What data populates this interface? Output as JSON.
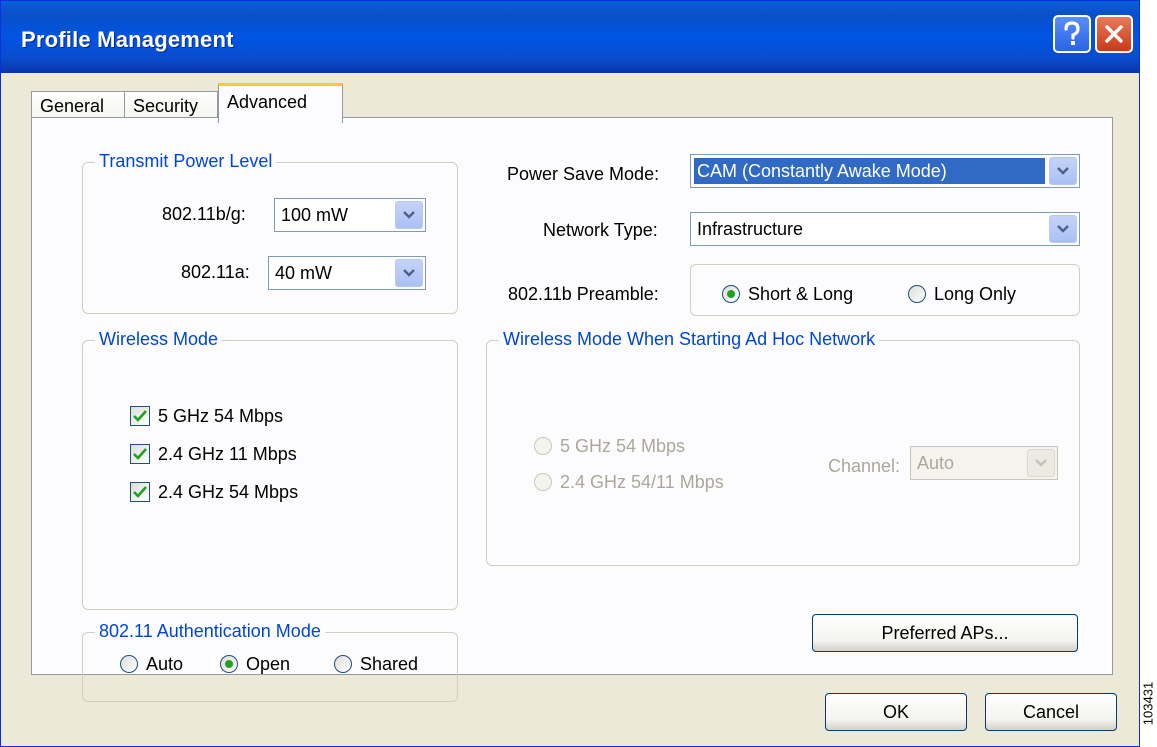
{
  "window": {
    "title": "Profile Management"
  },
  "tabs": [
    {
      "label": "General"
    },
    {
      "label": "Security"
    },
    {
      "label": "Advanced"
    }
  ],
  "transmit_power": {
    "legend": "Transmit Power Level",
    "bg_label": "802.11b/g:",
    "bg_value": "100 mW",
    "a_label": "802.11a:",
    "a_value": "40 mW"
  },
  "power_save": {
    "label": "Power Save Mode:",
    "value": "CAM (Constantly Awake Mode)"
  },
  "network_type": {
    "label": "Network Type:",
    "value": "Infrastructure"
  },
  "preamble": {
    "label": "802.11b Preamble:",
    "short_long": "Short & Long",
    "long_only": "Long Only",
    "selected": "Short & Long"
  },
  "wireless_mode": {
    "legend": "Wireless Mode",
    "items": [
      {
        "label": "5 GHz 54 Mbps",
        "checked": true
      },
      {
        "label": "2.4 GHz 11 Mbps",
        "checked": true
      },
      {
        "label": "2.4 GHz 54 Mbps",
        "checked": true
      }
    ]
  },
  "adhoc": {
    "legend": "Wireless Mode When Starting Ad Hoc Network",
    "opt1": "5 GHz 54 Mbps",
    "opt2": "2.4 GHz 54/11 Mbps",
    "channel_label": "Channel:",
    "channel_value": "Auto"
  },
  "auth": {
    "legend": "802.11 Authentication Mode",
    "auto": "Auto",
    "open": "Open",
    "shared": "Shared",
    "selected": "Open"
  },
  "buttons": {
    "preferred_aps": "Preferred APs...",
    "ok": "OK",
    "cancel": "Cancel"
  },
  "watermark": "103431",
  "colors": {
    "titlebar": "#0054e3",
    "legend": "#0046d5",
    "selection": "#316ac5",
    "radio_dot": "#21a121",
    "check": "#21a121",
    "dialog_bg": "#ece9d8"
  }
}
